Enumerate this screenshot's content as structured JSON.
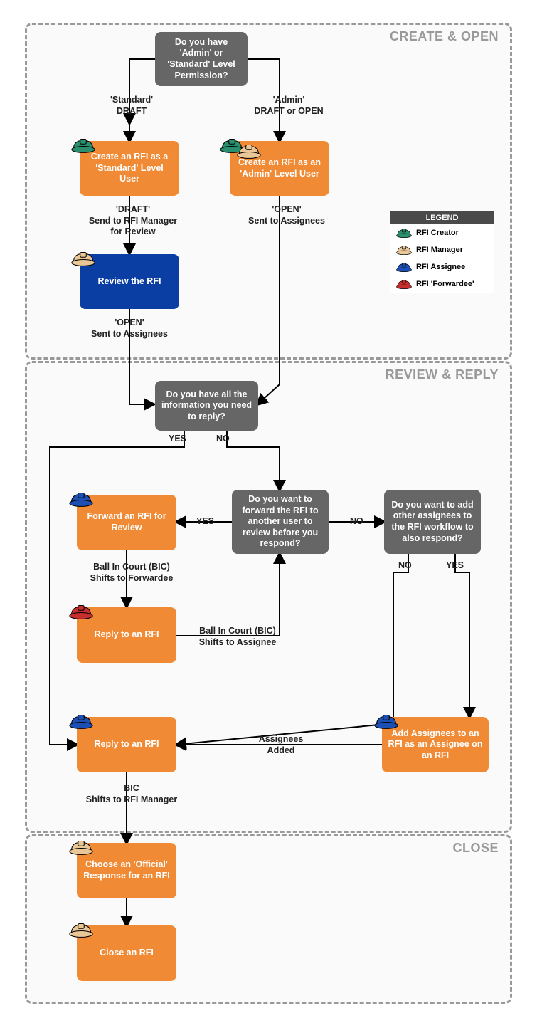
{
  "stages": {
    "s1": "CREATE & OPEN",
    "s2": "REVIEW & REPLY",
    "s3": "CLOSE"
  },
  "nodes": {
    "d1": "Do you have 'Admin' or 'Standard' Level Permission?",
    "p_std": "Create an RFI as a 'Standard' Level User",
    "p_adm": "Create an RFI as an 'Admin' Level User",
    "p_rev": "Review the RFI",
    "d2": "Do you have all the information you need to reply?",
    "d3": "Do you want to forward the RFI to another user to review before you respond?",
    "d4": "Do you want to add other assignees to the RFI workflow to also respond?",
    "p_fwd": "Forward an RFI for Review",
    "p_repf": "Reply to an RFI",
    "p_rep": "Reply to an RFI",
    "p_add": "Add Assignees to an RFI as an Assignee on an RFI",
    "p_choose": "Choose an 'Official' Response for an RFI",
    "p_close": "Close an RFI"
  },
  "labels": {
    "std_draft": "'Standard'\nDRAFT",
    "adm_open": "'Admin'\nDRAFT or OPEN",
    "draft_send": "'DRAFT'\nSend to RFI Manager\nfor Review",
    "open_sent_a": "'OPEN'\nSent to Assignees",
    "open_sent_b": "'OPEN'\nSent to Assignees",
    "yes1": "YES",
    "no1": "NO",
    "yes2": "YES",
    "no2": "NO",
    "yes3": "YES",
    "no3": "NO",
    "bic_fwd": "Ball In Court (BIC)\nShifts to Forwardee",
    "bic_asg": "Ball In Court (BIC)\nShifts to Assignee",
    "asg_added": "Assignees\nAdded",
    "bic_mgr": "BIC\nShifts to RFI Manager"
  },
  "legend": {
    "title": "LEGEND",
    "items": [
      {
        "role": "RFI Creator",
        "color": "#2a8f6e"
      },
      {
        "role": "RFI Manager",
        "color": "#e9c796"
      },
      {
        "role": "RFI Assignee",
        "color": "#1c4fb3"
      },
      {
        "role": "RFI 'Forwardee'",
        "color": "#c72f2f"
      }
    ]
  },
  "hat_colors": {
    "creator": "#2a8f6e",
    "manager": "#e9c796",
    "assignee": "#1c4fb3",
    "forwardee": "#c72f2f"
  }
}
